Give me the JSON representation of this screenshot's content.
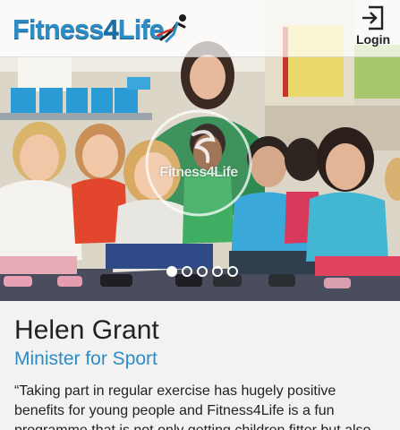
{
  "header": {
    "logo": {
      "part1": "Fitness",
      "part2": "4",
      "part3": "Life"
    },
    "login_label": "Login"
  },
  "hero": {
    "image_description_icon": "children-group-photo",
    "watermark_text": "Fitness4Life",
    "slides": [
      true,
      false,
      false,
      false,
      false
    ],
    "active_slide": 1
  },
  "testimonial": {
    "name": "Helen Grant",
    "title": "Minister for Sport",
    "quote": "“Taking part in regular exercise has hugely positive benefits for young people and Fitness4Life is a fun programme that is not only getting children fitter but also"
  },
  "colors": {
    "brand_blue": "#2d8cc4",
    "dark_text": "#222222",
    "background": "#f2f2f2"
  }
}
